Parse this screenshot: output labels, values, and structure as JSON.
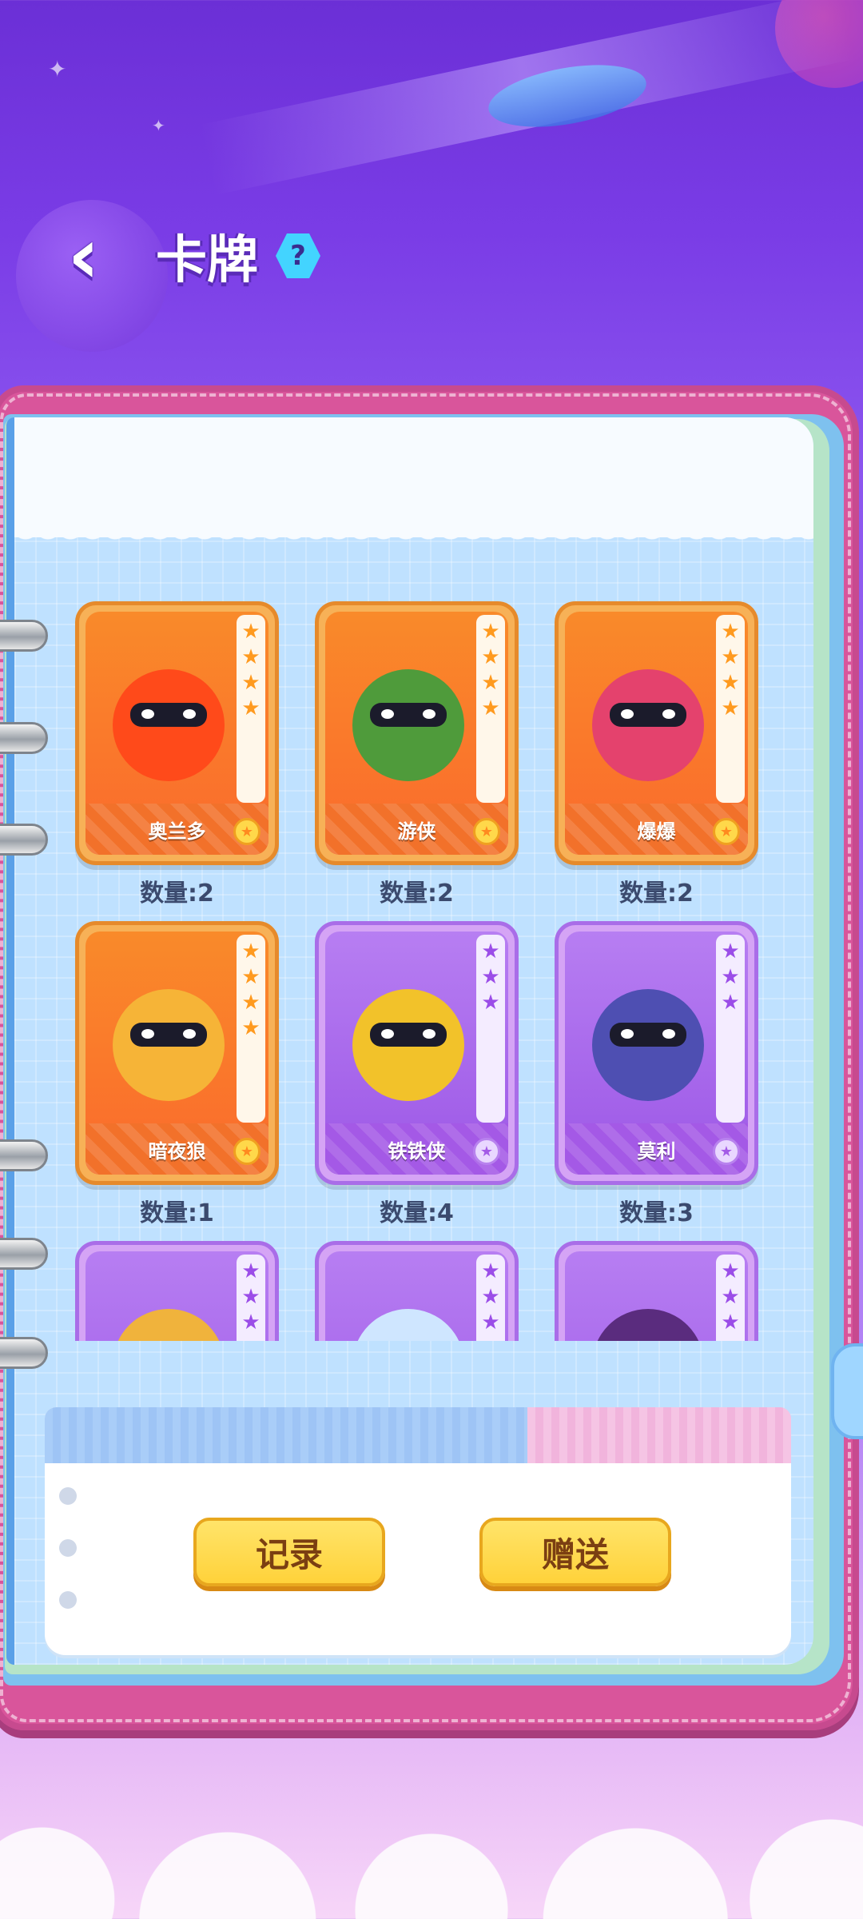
{
  "header": {
    "title": "卡牌",
    "help_label": "?"
  },
  "cards": [
    {
      "name": "奥兰多",
      "count_label": "数量:2",
      "rarity": "orange",
      "stars": 4,
      "body_color": "#ff4a1a"
    },
    {
      "name": "游侠",
      "count_label": "数量:2",
      "rarity": "orange",
      "stars": 4,
      "body_color": "#4f9b3b"
    },
    {
      "name": "爆爆",
      "count_label": "数量:2",
      "rarity": "orange",
      "stars": 4,
      "body_color": "#e4426d"
    },
    {
      "name": "暗夜狼",
      "count_label": "数量:1",
      "rarity": "orange",
      "stars": 4,
      "body_color": "#f6b437"
    },
    {
      "name": "铁铁侠",
      "count_label": "数量:4",
      "rarity": "purple",
      "stars": 3,
      "body_color": "#f2c22a"
    },
    {
      "name": "莫利",
      "count_label": "数量:3",
      "rarity": "purple",
      "stars": 3,
      "body_color": "#4e4fb2"
    },
    {
      "name": "",
      "count_label": "",
      "rarity": "purple",
      "stars": 3,
      "body_color": "#f0b33c"
    },
    {
      "name": "",
      "count_label": "",
      "rarity": "purple",
      "stars": 3,
      "body_color": "#cfe6ff"
    },
    {
      "name": "",
      "count_label": "",
      "rarity": "purple",
      "stars": 3,
      "body_color": "#5a2c7e"
    }
  ],
  "actions": {
    "record_label": "记录",
    "gift_label": "赠送"
  },
  "icons": {
    "back": "double-chevron-left-icon",
    "help": "question-hex-icon",
    "rail_star": "star-icon",
    "rarity_badge": "star-badge-icon"
  }
}
